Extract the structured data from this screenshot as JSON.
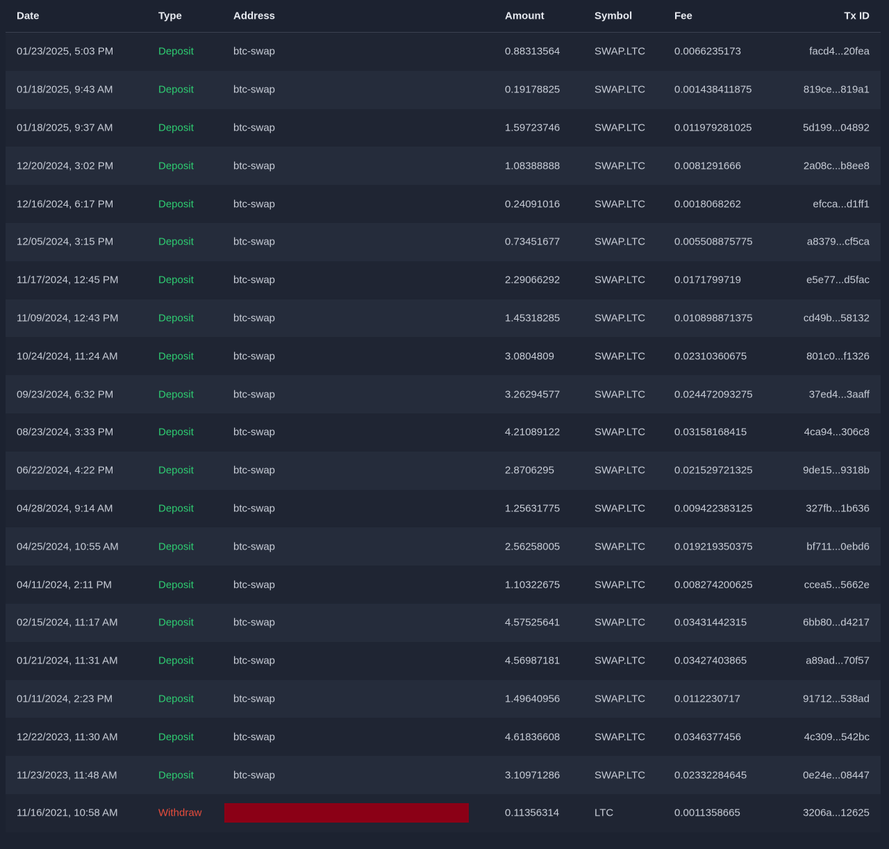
{
  "columns": {
    "date": "Date",
    "type": "Type",
    "address": "Address",
    "amount": "Amount",
    "symbol": "Symbol",
    "fee": "Fee",
    "txid": "Tx ID"
  },
  "colors": {
    "deposit": "#2ecc71",
    "withdraw": "#e74c3c",
    "redaction": "#8b0016",
    "background": "#1c2230"
  },
  "rows": [
    {
      "date": "01/23/2025, 5:03 PM",
      "type": "Deposit",
      "address": "btc-swap",
      "amount": "0.88313564",
      "symbol": "SWAP.LTC",
      "fee": "0.0066235173",
      "txid": "facd4...20fea"
    },
    {
      "date": "01/18/2025, 9:43 AM",
      "type": "Deposit",
      "address": "btc-swap",
      "amount": "0.19178825",
      "symbol": "SWAP.LTC",
      "fee": "0.001438411875",
      "txid": "819ce...819a1"
    },
    {
      "date": "01/18/2025, 9:37 AM",
      "type": "Deposit",
      "address": "btc-swap",
      "amount": "1.59723746",
      "symbol": "SWAP.LTC",
      "fee": "0.011979281025",
      "txid": "5d199...04892"
    },
    {
      "date": "12/20/2024, 3:02 PM",
      "type": "Deposit",
      "address": "btc-swap",
      "amount": "1.08388888",
      "symbol": "SWAP.LTC",
      "fee": "0.0081291666",
      "txid": "2a08c...b8ee8"
    },
    {
      "date": "12/16/2024, 6:17 PM",
      "type": "Deposit",
      "address": "btc-swap",
      "amount": "0.24091016",
      "symbol": "SWAP.LTC",
      "fee": "0.0018068262",
      "txid": "efcca...d1ff1"
    },
    {
      "date": "12/05/2024, 3:15 PM",
      "type": "Deposit",
      "address": "btc-swap",
      "amount": "0.73451677",
      "symbol": "SWAP.LTC",
      "fee": "0.005508875775",
      "txid": "a8379...cf5ca"
    },
    {
      "date": "11/17/2024, 12:45 PM",
      "type": "Deposit",
      "address": "btc-swap",
      "amount": "2.29066292",
      "symbol": "SWAP.LTC",
      "fee": "0.0171799719",
      "txid": "e5e77...d5fac"
    },
    {
      "date": "11/09/2024, 12:43 PM",
      "type": "Deposit",
      "address": "btc-swap",
      "amount": "1.45318285",
      "symbol": "SWAP.LTC",
      "fee": "0.010898871375",
      "txid": "cd49b...58132"
    },
    {
      "date": "10/24/2024, 11:24 AM",
      "type": "Deposit",
      "address": "btc-swap",
      "amount": "3.0804809",
      "symbol": "SWAP.LTC",
      "fee": "0.02310360675",
      "txid": "801c0...f1326"
    },
    {
      "date": "09/23/2024, 6:32 PM",
      "type": "Deposit",
      "address": "btc-swap",
      "amount": "3.26294577",
      "symbol": "SWAP.LTC",
      "fee": "0.024472093275",
      "txid": "37ed4...3aaff"
    },
    {
      "date": "08/23/2024, 3:33 PM",
      "type": "Deposit",
      "address": "btc-swap",
      "amount": "4.21089122",
      "symbol": "SWAP.LTC",
      "fee": "0.03158168415",
      "txid": "4ca94...306c8"
    },
    {
      "date": "06/22/2024, 4:22 PM",
      "type": "Deposit",
      "address": "btc-swap",
      "amount": "2.8706295",
      "symbol": "SWAP.LTC",
      "fee": "0.021529721325",
      "txid": "9de15...9318b"
    },
    {
      "date": "04/28/2024, 9:14 AM",
      "type": "Deposit",
      "address": "btc-swap",
      "amount": "1.25631775",
      "symbol": "SWAP.LTC",
      "fee": "0.009422383125",
      "txid": "327fb...1b636"
    },
    {
      "date": "04/25/2024, 10:55 AM",
      "type": "Deposit",
      "address": "btc-swap",
      "amount": "2.56258005",
      "symbol": "SWAP.LTC",
      "fee": "0.019219350375",
      "txid": "bf711...0ebd6"
    },
    {
      "date": "04/11/2024, 2:11 PM",
      "type": "Deposit",
      "address": "btc-swap",
      "amount": "1.10322675",
      "symbol": "SWAP.LTC",
      "fee": "0.008274200625",
      "txid": "ccea5...5662e"
    },
    {
      "date": "02/15/2024, 11:17 AM",
      "type": "Deposit",
      "address": "btc-swap",
      "amount": "4.57525641",
      "symbol": "SWAP.LTC",
      "fee": "0.03431442315",
      "txid": "6bb80...d4217"
    },
    {
      "date": "01/21/2024, 11:31 AM",
      "type": "Deposit",
      "address": "btc-swap",
      "amount": "4.56987181",
      "symbol": "SWAP.LTC",
      "fee": "0.03427403865",
      "txid": "a89ad...70f57"
    },
    {
      "date": "01/11/2024, 2:23 PM",
      "type": "Deposit",
      "address": "btc-swap",
      "amount": "1.49640956",
      "symbol": "SWAP.LTC",
      "fee": "0.0112230717",
      "txid": "91712...538ad"
    },
    {
      "date": "12/22/2023, 11:30 AM",
      "type": "Deposit",
      "address": "btc-swap",
      "amount": "4.61836608",
      "symbol": "SWAP.LTC",
      "fee": "0.0346377456",
      "txid": "4c309...542bc"
    },
    {
      "date": "11/23/2023, 11:48 AM",
      "type": "Deposit",
      "address": "btc-swap",
      "amount": "3.10971286",
      "symbol": "SWAP.LTC",
      "fee": "0.02332284645",
      "txid": "0e24e...08447"
    },
    {
      "date": "11/16/2021, 10:58 AM",
      "type": "Withdraw",
      "address": "",
      "redacted": true,
      "amount": "0.11356314",
      "symbol": "LTC",
      "fee": "0.0011358665",
      "txid": "3206a...12625"
    }
  ]
}
